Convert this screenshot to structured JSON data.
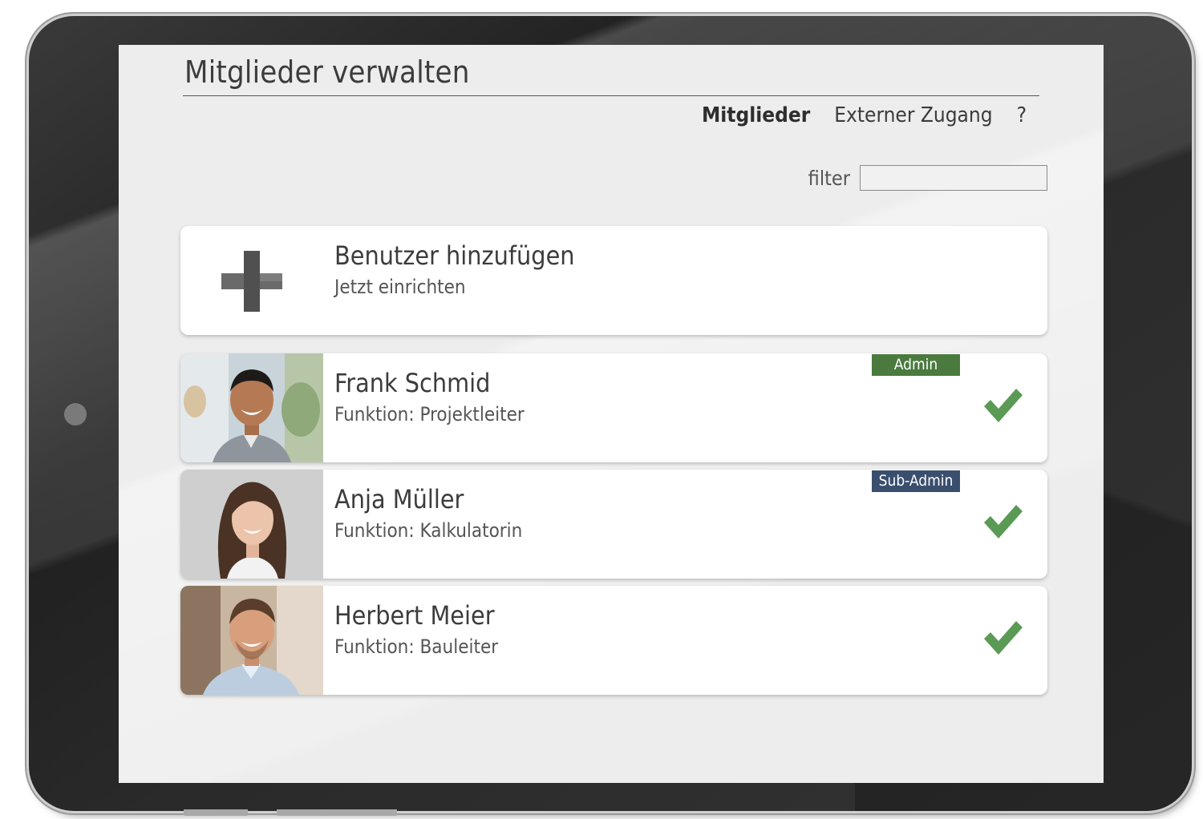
{
  "header": {
    "title": "Mitglieder verwalten",
    "tabs": [
      {
        "label": "Mitglieder",
        "active": true
      },
      {
        "label": "Externer Zugang",
        "active": false
      },
      {
        "label": "?",
        "active": false
      }
    ]
  },
  "filter": {
    "label": "filter",
    "value": "",
    "placeholder": ""
  },
  "add_user": {
    "title": "Benutzer hinzufügen",
    "subtitle": "Jetzt einrichten",
    "icon": "plus-icon"
  },
  "members": [
    {
      "name": "Frank Schmid",
      "function": "Funktion: Projektleiter",
      "role": "Admin",
      "status_icon": "check-icon"
    },
    {
      "name": "Anja Müller",
      "function": "Funktion: Kalkulatorin",
      "role": "Sub-Admin",
      "status_icon": "check-icon"
    },
    {
      "name": "Herbert Meier",
      "function": "Funktion: Bauleiter",
      "role": "",
      "status_icon": "check-icon"
    }
  ],
  "colors": {
    "admin_badge": "#4b7a3f",
    "subadmin_badge": "#3a4f6e",
    "check": "#5a9a55",
    "screen_bg": "#ededed",
    "device_frame": "#2a2a2a"
  }
}
